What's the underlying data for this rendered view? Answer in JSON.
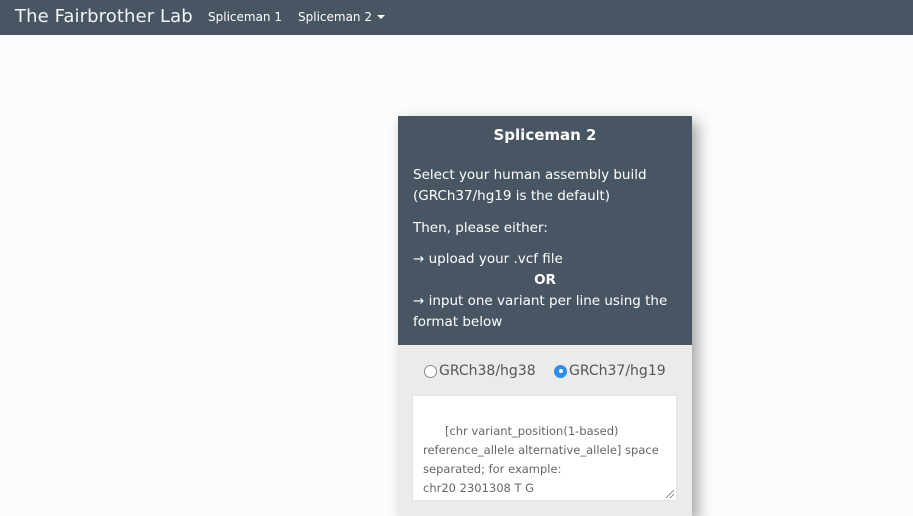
{
  "navbar": {
    "brand": "The Fairbrother Lab",
    "items": [
      {
        "label": "Spliceman 1"
      },
      {
        "label": "Spliceman 2"
      }
    ]
  },
  "panel": {
    "title": "Spliceman 2",
    "instructions": {
      "line1": "Select your human assembly build (GRCh37/hg19 is the default)",
      "line2": "Then, please either:",
      "option1": "→ upload your .vcf file",
      "or": "OR",
      "option2": "→ input one variant per line using the format below"
    },
    "assembly": {
      "options": [
        {
          "label": "GRCh38/hg38",
          "checked": false
        },
        {
          "label": "GRCh37/hg19",
          "checked": true
        }
      ]
    },
    "variant_input": {
      "placeholder": "[chr variant_position(1-based) reference_allele alternative_allele] space separated; for example:\nchr20 2301308 T G"
    }
  },
  "colors": {
    "navbar_bg": "#485563",
    "panel_bg": "#485563",
    "form_bg": "#ebebeb",
    "radio_checked": "#2e8de8"
  }
}
